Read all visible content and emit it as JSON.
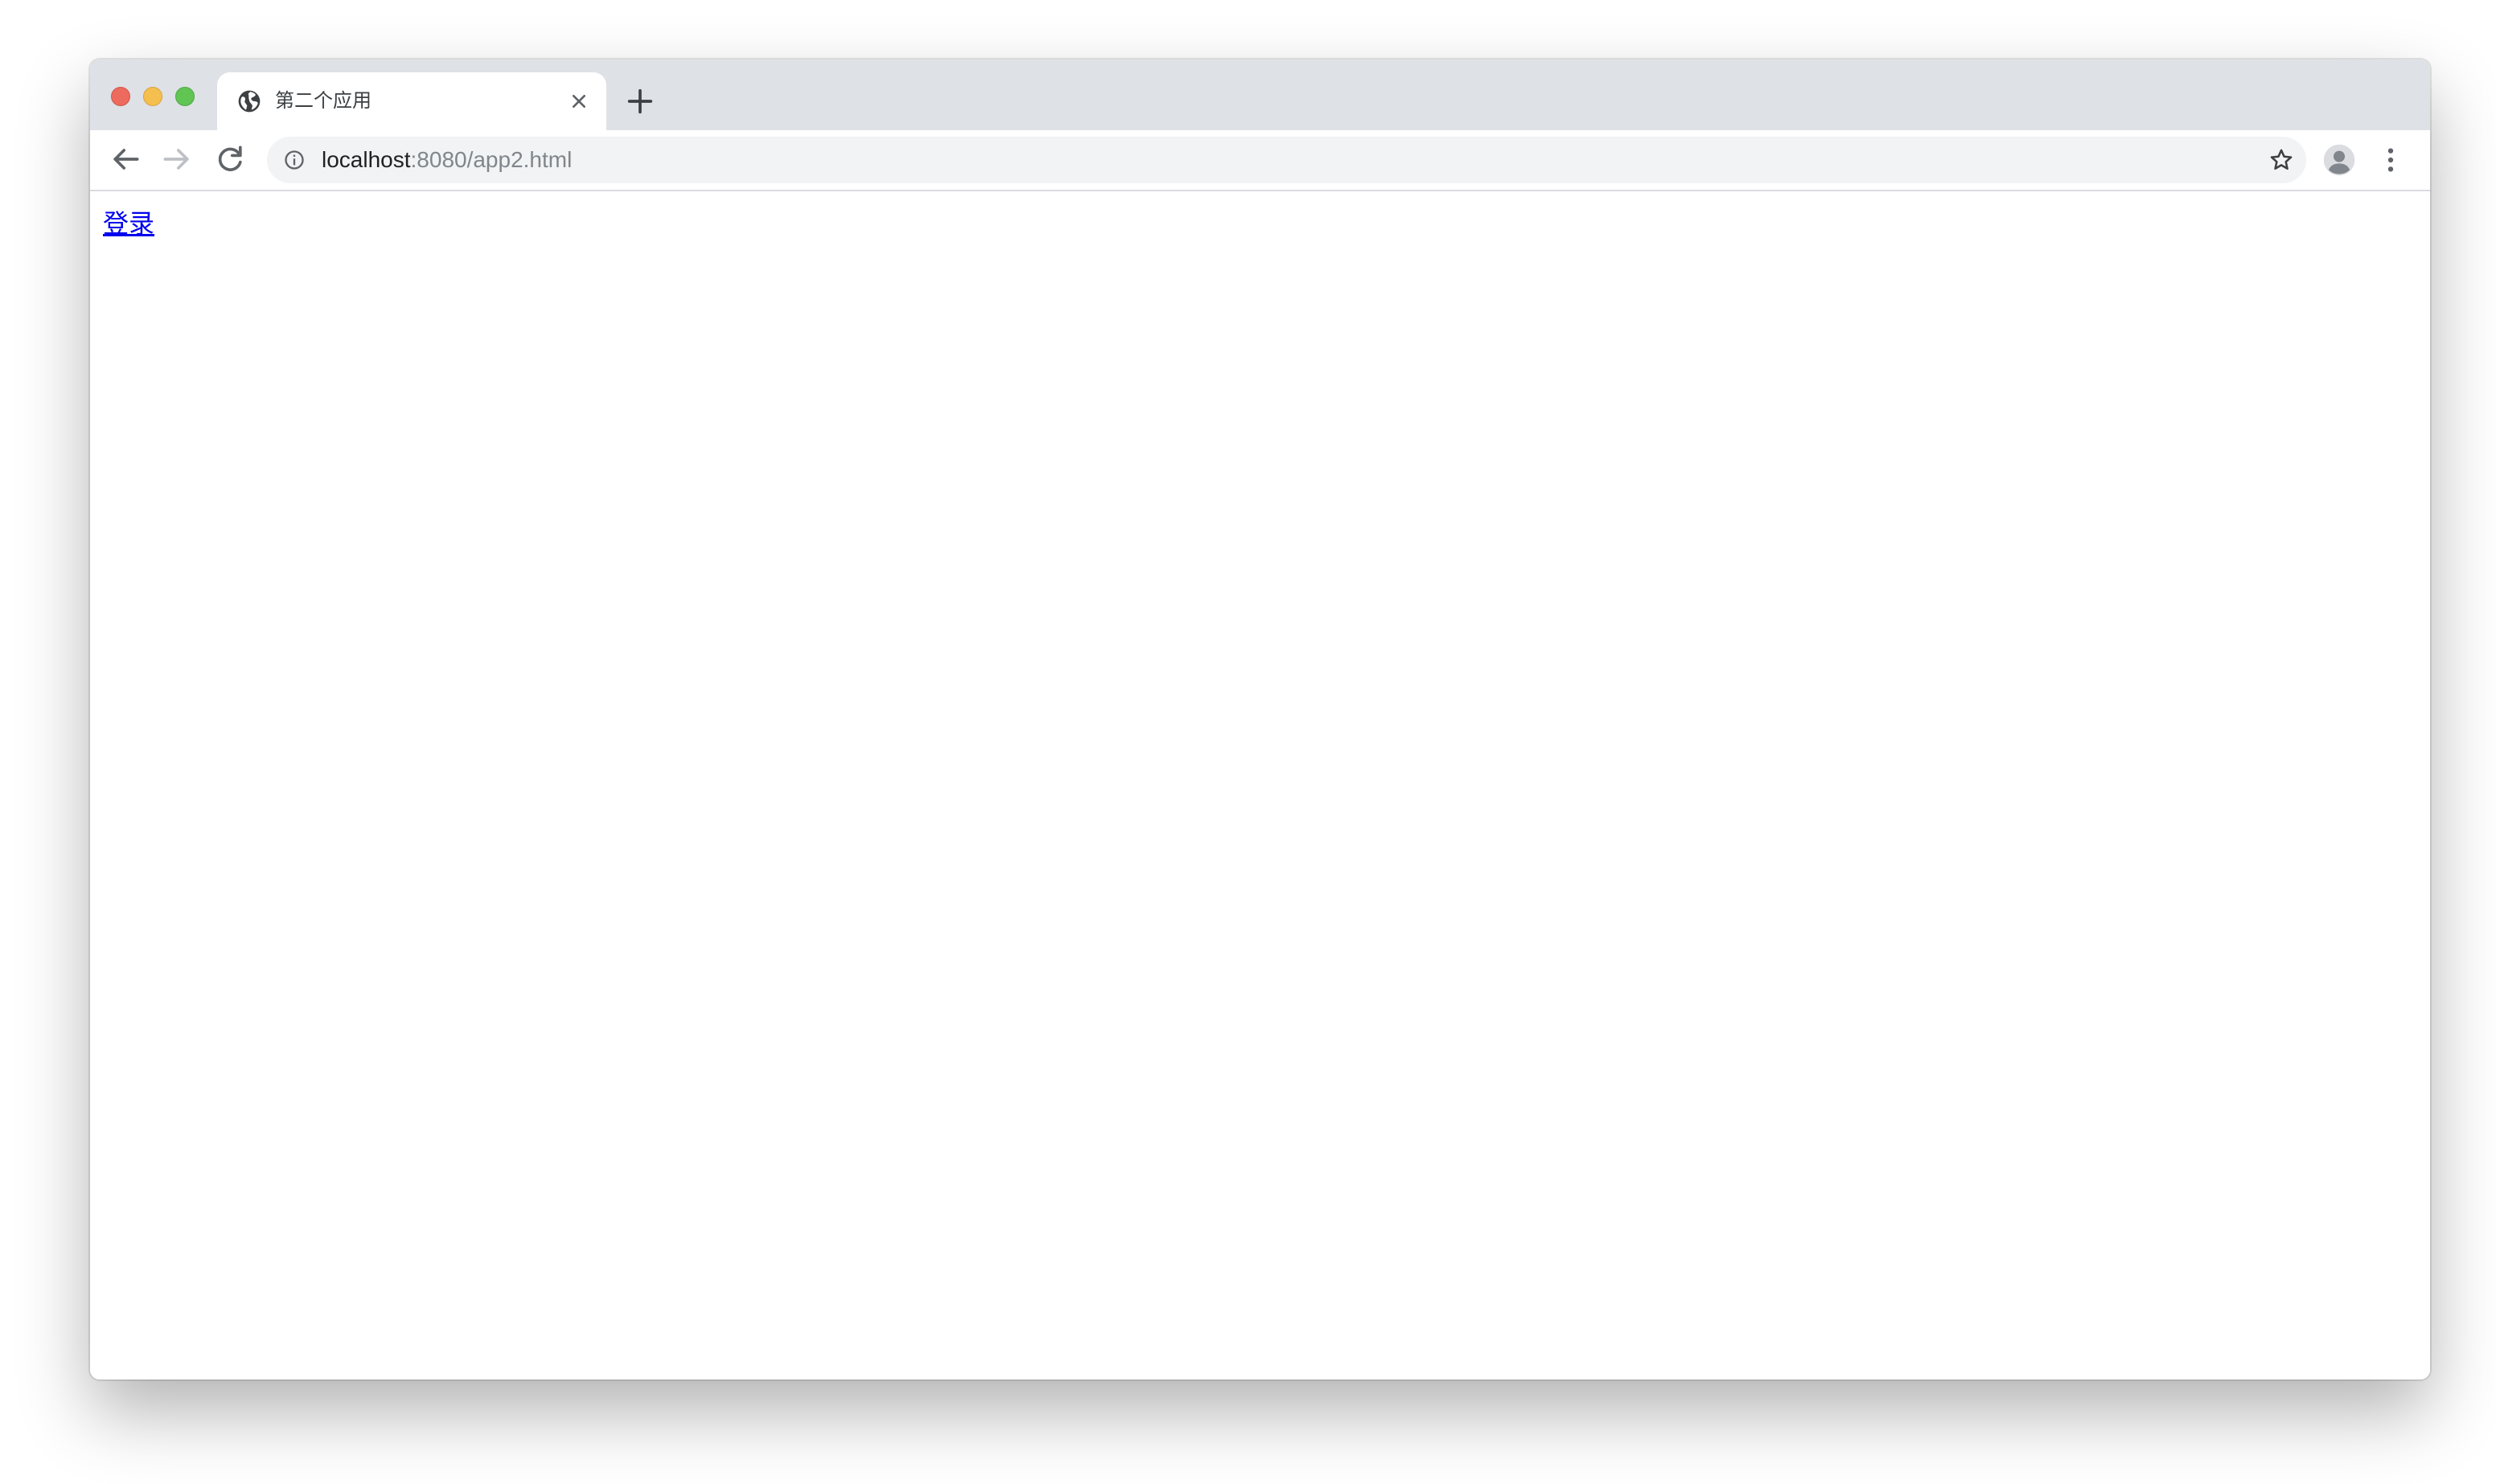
{
  "browser": {
    "tab": {
      "title": "第二个应用",
      "favicon": "globe-icon"
    },
    "address_bar": {
      "host": "localhost",
      "path": ":8080/app2.html"
    },
    "colors": {
      "tabstrip_bg": "#dee1e6",
      "omnibox_bg": "#f1f3f4",
      "close_light": "#ed6a5e",
      "minimize_light": "#f5bf4f",
      "maximize_light": "#61c554"
    }
  },
  "page": {
    "login_link": "登录",
    "link_color": "#0000ee"
  }
}
